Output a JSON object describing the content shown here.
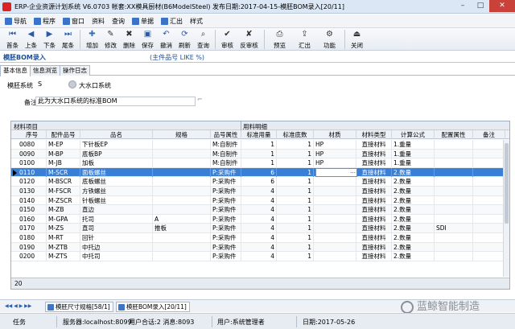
{
  "window": {
    "title": "ERP-企业资源计划系统 V6.0703 帐套:XX模具厨材(B6ModelSteel) 发布日期:2017-04-15-模胚BOM录入[20/11]",
    "minimize": "–",
    "maximize": "□",
    "close": "✕"
  },
  "menu": [
    {
      "label": "导航",
      "icon": "nav-icon",
      "color": "#3b73c9"
    },
    {
      "label": "程序",
      "icon": "program-icon",
      "color": "#3b73c9"
    },
    {
      "label": "窗口",
      "icon": "window-icon",
      "color": "#3b73c9"
    },
    {
      "label": "资料",
      "icon": "",
      "color": ""
    },
    {
      "label": "查询",
      "icon": "",
      "color": ""
    },
    {
      "label": "单据",
      "icon": "doc-icon",
      "color": "#3b73c9"
    },
    {
      "label": "汇出",
      "icon": "export-icon",
      "color": "#3b73c9"
    },
    {
      "label": "样式",
      "icon": "",
      "color": ""
    }
  ],
  "toolbar": [
    {
      "label": "首条",
      "icon": "first-record-icon",
      "glyph": "⏮"
    },
    {
      "label": "上条",
      "icon": "prev-record-icon",
      "glyph": "◀"
    },
    {
      "label": "下条",
      "icon": "next-record-icon",
      "glyph": "▶"
    },
    {
      "label": "尾条",
      "icon": "last-record-icon",
      "glyph": "⏭"
    },
    {
      "label": "增加",
      "icon": "add-icon",
      "glyph": "✚"
    },
    {
      "label": "修改",
      "icon": "edit-icon",
      "glyph": "✎"
    },
    {
      "label": "删除",
      "icon": "delete-icon",
      "glyph": "✖"
    },
    {
      "label": "保存",
      "icon": "save-icon",
      "glyph": "▣"
    },
    {
      "label": "撤消",
      "icon": "undo-icon",
      "glyph": "↶"
    },
    {
      "label": "刷新",
      "icon": "refresh-icon",
      "glyph": "⟳"
    },
    {
      "label": "查询",
      "icon": "query-icon",
      "glyph": "⌕"
    },
    {
      "label": "审核",
      "icon": "approve-icon",
      "glyph": "✔"
    },
    {
      "label": "反审核",
      "icon": "unapprove-icon",
      "glyph": "✘"
    },
    {
      "label": "预览",
      "icon": "preview-icon",
      "glyph": "⎙"
    },
    {
      "label": "汇出",
      "icon": "export-icon",
      "glyph": "⇪"
    },
    {
      "label": "功能",
      "icon": "function-icon",
      "glyph": "⚙"
    },
    {
      "label": "关闭",
      "icon": "close-icon",
      "glyph": "⏏"
    }
  ],
  "form_title": "模胚BOM录入",
  "form_subtitle": "(主件品号 LIKE %)",
  "tabs": [
    "基本信息",
    "信息浏览",
    "操作日志"
  ],
  "fields": {
    "system_label": "模胚系统",
    "system_code": "S",
    "system_name": "大水口系统",
    "note_label": "备注",
    "note_value": "此为大水口系统的标准BOM"
  },
  "grid": {
    "group_left": "材料项目",
    "group_right": "用料明细",
    "columns": [
      "序号",
      "配件品号",
      "品名",
      "规格",
      "品号属性",
      "标准用量",
      "标准底数",
      "材质",
      "材料类型",
      "计算公式",
      "配置属性",
      "备注"
    ],
    "rows": [
      [
        "0080",
        "M-EP",
        "下针板EP",
        "",
        "M:自制件",
        "1",
        "1",
        "HP",
        "直接材料",
        "1.重量",
        "",
        ""
      ],
      [
        "0090",
        "M-BP",
        "底板BP",
        "",
        "M:自制件",
        "1",
        "1",
        "HP",
        "直接材料",
        "1.重量",
        "",
        ""
      ],
      [
        "0100",
        "M-JB",
        "加板",
        "",
        "M:自制件",
        "1",
        "1",
        "HP",
        "直接材料",
        "1.重量",
        "",
        ""
      ],
      [
        "0110",
        "M-SCR",
        "面板螺丝",
        "",
        "P:采购件",
        "6",
        "1",
        "",
        "直接材料",
        "2.数量",
        "",
        ""
      ],
      [
        "0120",
        "M-BSCR",
        "底板螺丝",
        "",
        "P:采购件",
        "6",
        "1",
        "",
        "直接材料",
        "2.数量",
        "",
        ""
      ],
      [
        "0130",
        "M-FSCR",
        "方铁螺丝",
        "",
        "P:采购件",
        "4",
        "1",
        "",
        "直接材料",
        "2.数量",
        "",
        ""
      ],
      [
        "0140",
        "M-ZSCR",
        "针板螺丝",
        "",
        "P:采购件",
        "4",
        "1",
        "",
        "直接材料",
        "2.数量",
        "",
        ""
      ],
      [
        "0150",
        "M-ZB",
        "直边",
        "",
        "P:采购件",
        "4",
        "1",
        "",
        "直接材料",
        "2.数量",
        "",
        ""
      ],
      [
        "0160",
        "M-GPA",
        "托司",
        "A",
        "P:采购件",
        "4",
        "1",
        "",
        "直接材料",
        "2.数量",
        "",
        ""
      ],
      [
        "0170",
        "M-ZS",
        "直司",
        "推板",
        "P:采购件",
        "4",
        "1",
        "",
        "直接材料",
        "2.数量",
        "SDI",
        ""
      ],
      [
        "0180",
        "M-RT",
        "回针",
        "",
        "P:采购件",
        "4",
        "1",
        "",
        "直接材料",
        "2.数量",
        "",
        ""
      ],
      [
        "0190",
        "M-ZTB",
        "中托边",
        "",
        "P:采购件",
        "4",
        "1",
        "",
        "直接材料",
        "2.数量",
        "",
        ""
      ],
      [
        "0200",
        "M-ZTS",
        "中托司",
        "",
        "P:采购件",
        "4",
        "1",
        "",
        "直接材料",
        "2.数量",
        "",
        ""
      ]
    ],
    "selected_row": 3,
    "editor_ellipsis": "…",
    "footer_count": "20"
  },
  "bottom_tabs": {
    "nav": "◀◀ ◀ ▶ ▶▶",
    "items": [
      "模胚尺寸规格[58/1]",
      "模胚BOM录入[20/11]"
    ]
  },
  "status": {
    "task": "任务",
    "server": "服务器:localhost:8099",
    "user_count": "用户合话:2 消息:8093",
    "user": "用户:系统管理者",
    "date": "日期:2017-05-26"
  },
  "watermark": "蓝鲸智能制造"
}
